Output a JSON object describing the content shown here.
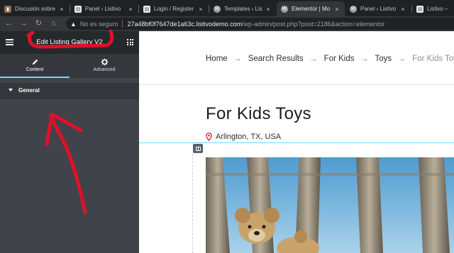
{
  "browser": {
    "tabs": [
      {
        "title": "Discusión sobre",
        "active": false,
        "favicon": "folder-icon"
      },
      {
        "title": "Panel ‹ Listivo",
        "active": false,
        "favicon": "page-icon"
      },
      {
        "title": "Login / Register",
        "active": false,
        "favicon": "page-icon"
      },
      {
        "title": "Templates ‹ Listivo",
        "active": false,
        "favicon": "wordpress-icon"
      },
      {
        "title": "Elementor | Mo",
        "active": true,
        "favicon": "wordpress-icon"
      },
      {
        "title": "Panel ‹ Listivo",
        "active": false,
        "favicon": "wordpress-icon"
      },
      {
        "title": "Listivo – C",
        "active": false,
        "favicon": "page-icon"
      }
    ],
    "close_glyph": "×",
    "address": {
      "security_label": "No es seguro",
      "host": "27a48bf0f7647de1a63c.listivodemo.com",
      "path": "/wp-admin/post.php?post=2186&action=elementor"
    }
  },
  "editor": {
    "title": "Edit Listing Gallery V2",
    "tabs": [
      {
        "label": "Content",
        "icon": "pencil-icon",
        "active": true
      },
      {
        "label": "Advanced",
        "icon": "gear-icon",
        "active": false
      }
    ],
    "section_label": "General",
    "collapse_glyph": "‹"
  },
  "preview": {
    "breadcrumb": [
      "Home",
      "Search Results",
      "For Kids",
      "Toys",
      "For Kids Toys"
    ],
    "breadcrumb_separator": "→",
    "page_title": "For Kids Toys",
    "location": "Arlington, TX, USA"
  },
  "colors": {
    "accent": "#71d7f7",
    "annotation": "#e0102a",
    "breadcrumb_separator": "#e85a5a",
    "panel_bg": "#404349"
  }
}
